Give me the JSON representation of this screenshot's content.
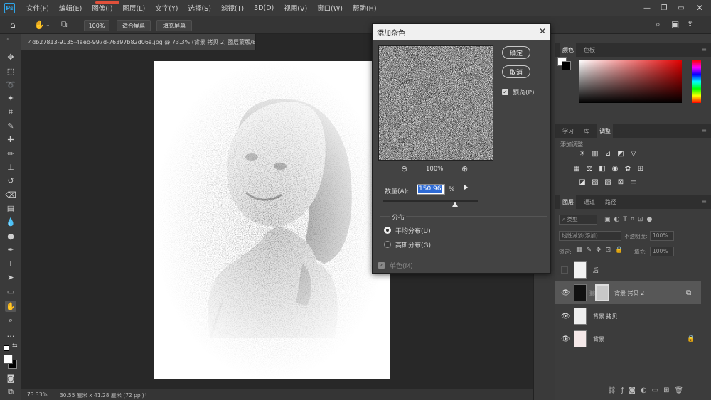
{
  "app": {
    "logo": "Ps"
  },
  "menu": [
    "文件(F)",
    "编辑(E)",
    "图像(I)",
    "图层(L)",
    "文字(Y)",
    "选择(S)",
    "滤镜(T)",
    "3D(D)",
    "视图(V)",
    "窗口(W)",
    "帮助(H)"
  ],
  "options": {
    "zoom": "100%",
    "fit_screen": "适合屏幕",
    "fill_screen": "填充屏幕"
  },
  "document": {
    "tab_title": "4db27813-9135-4aeb-997d-76397b82d06a.jpg @ 73.3% (背景 拷贝 2, 图层蒙版/8) *",
    "close": "×"
  },
  "status": {
    "zoom": "73.33%",
    "size": "30.55 厘米 x 41.28 厘米 (72 ppi)",
    "arrow": "›"
  },
  "dialog": {
    "title": "添加杂色",
    "ok": "确定",
    "cancel": "取消",
    "preview_label": "预览(P)",
    "preview_checked": true,
    "zoom_level": "100%",
    "amount_label": "数量(A):",
    "amount_value": "150.96",
    "amount_unit": "%",
    "distribution_label": "分布",
    "uniform": "平均分布(U)",
    "gaussian": "高斯分布(G)",
    "selected_distribution": "uniform",
    "mono": "单色(M)",
    "mono_checked": true
  },
  "color_panel": {
    "tabs": [
      "颜色",
      "色板"
    ]
  },
  "adjust_panel": {
    "tabs": [
      "学习",
      "库",
      "调整"
    ],
    "add_label": "添加调整"
  },
  "layers_panel": {
    "tabs": [
      "图层",
      "通道",
      "路径"
    ],
    "filter": "类型",
    "blend_mode": "线性减淡(添加)",
    "opacity_label": "不透明度:",
    "opacity_value": "100%",
    "lock_label": "锁定:",
    "fill_label": "填充:",
    "fill_value": "100%",
    "layers": [
      {
        "name": "后",
        "visible": false
      },
      {
        "name": "背景 拷贝 2",
        "visible": true,
        "selected": true
      },
      {
        "name": "背景 拷贝",
        "visible": true
      },
      {
        "name": "背景",
        "visible": true,
        "locked": true
      }
    ]
  }
}
